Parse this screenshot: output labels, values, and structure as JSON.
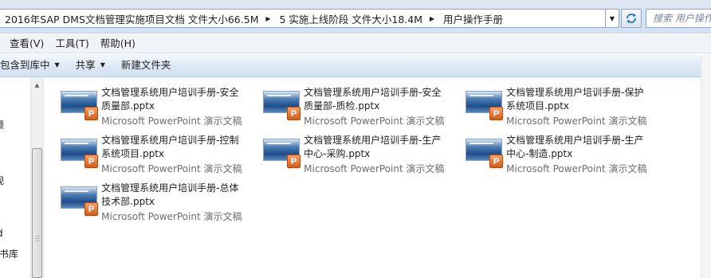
{
  "address_bar": {
    "crumbs": [
      "2016年SAP DMS文档管理实施项目文档 文件大小66.5M",
      "5 实施上线阶段 文件大小18.4M",
      "用户操作手册"
    ],
    "search_placeholder": "搜索 用户操作手册"
  },
  "menu": [
    "查看(V)",
    "工具(T)",
    "帮助(H)"
  ],
  "command_bar": {
    "include_library": "包含到库中",
    "share": "共享",
    "new_folder": "新建文件夹"
  },
  "nav_pane": {
    "fragments": [
      "频",
      "视",
      "d",
      "书库"
    ]
  },
  "files": [
    {
      "name": "文档管理系统用户培训手册-安全质量部.pptx",
      "type": "Microsoft PowerPoint 演示文稿"
    },
    {
      "name": "文档管理系统用户培训手册-安全质量部-质检.pptx",
      "type": "Microsoft PowerPoint 演示文稿"
    },
    {
      "name": "文档管理系统用户培训手册-保护系统项目.pptx",
      "type": "Microsoft PowerPoint 演示文稿"
    },
    {
      "name": "文档管理系统用户培训手册-控制系统项目.pptx",
      "type": "Microsoft PowerPoint 演示文稿"
    },
    {
      "name": "文档管理系统用户培训手册-生产中心-采购.pptx",
      "type": "Microsoft PowerPoint 演示文稿"
    },
    {
      "name": "文档管理系统用户培训手册-生产中心-制造.pptx",
      "type": "Microsoft PowerPoint 演示文稿"
    },
    {
      "name": "文档管理系统用户培训手册-总体技术部.pptx",
      "type": "Microsoft PowerPoint 演示文稿"
    }
  ],
  "icons": {
    "file_icon": "powerpoint-file-icon",
    "badge_letter": "P"
  },
  "colors": {
    "chrome_bg": "#d3e1f1",
    "secondary_text": "#6d6d6d",
    "ppt_orange": "#d35b1b"
  }
}
